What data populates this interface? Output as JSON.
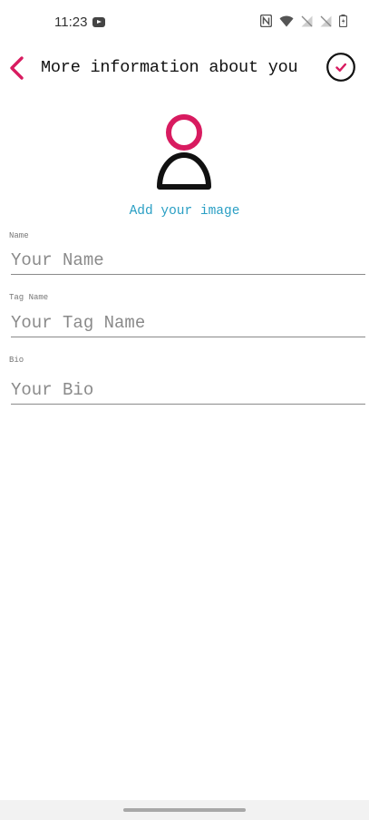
{
  "status_bar": {
    "time": "11:23",
    "icons": [
      "youtube-icon",
      "nfc-icon",
      "wifi-icon",
      "signal-off-icon",
      "signal-off-icon",
      "battery-icon"
    ]
  },
  "header": {
    "title": "More information about you",
    "back_icon": "chevron-left-icon",
    "confirm_icon": "check-circle-icon"
  },
  "avatar": {
    "icon": "user-avatar-icon",
    "add_image_label": "Add your image"
  },
  "form": {
    "fields": [
      {
        "label": "Name",
        "placeholder": "Your Name",
        "value": ""
      },
      {
        "label": "Tag Name",
        "placeholder": "Your Tag Name",
        "value": ""
      },
      {
        "label": "Bio",
        "placeholder": "Your Bio",
        "value": ""
      }
    ]
  },
  "colors": {
    "accent": "#d81b60",
    "link": "#2a9fc4",
    "text": "#111111"
  }
}
